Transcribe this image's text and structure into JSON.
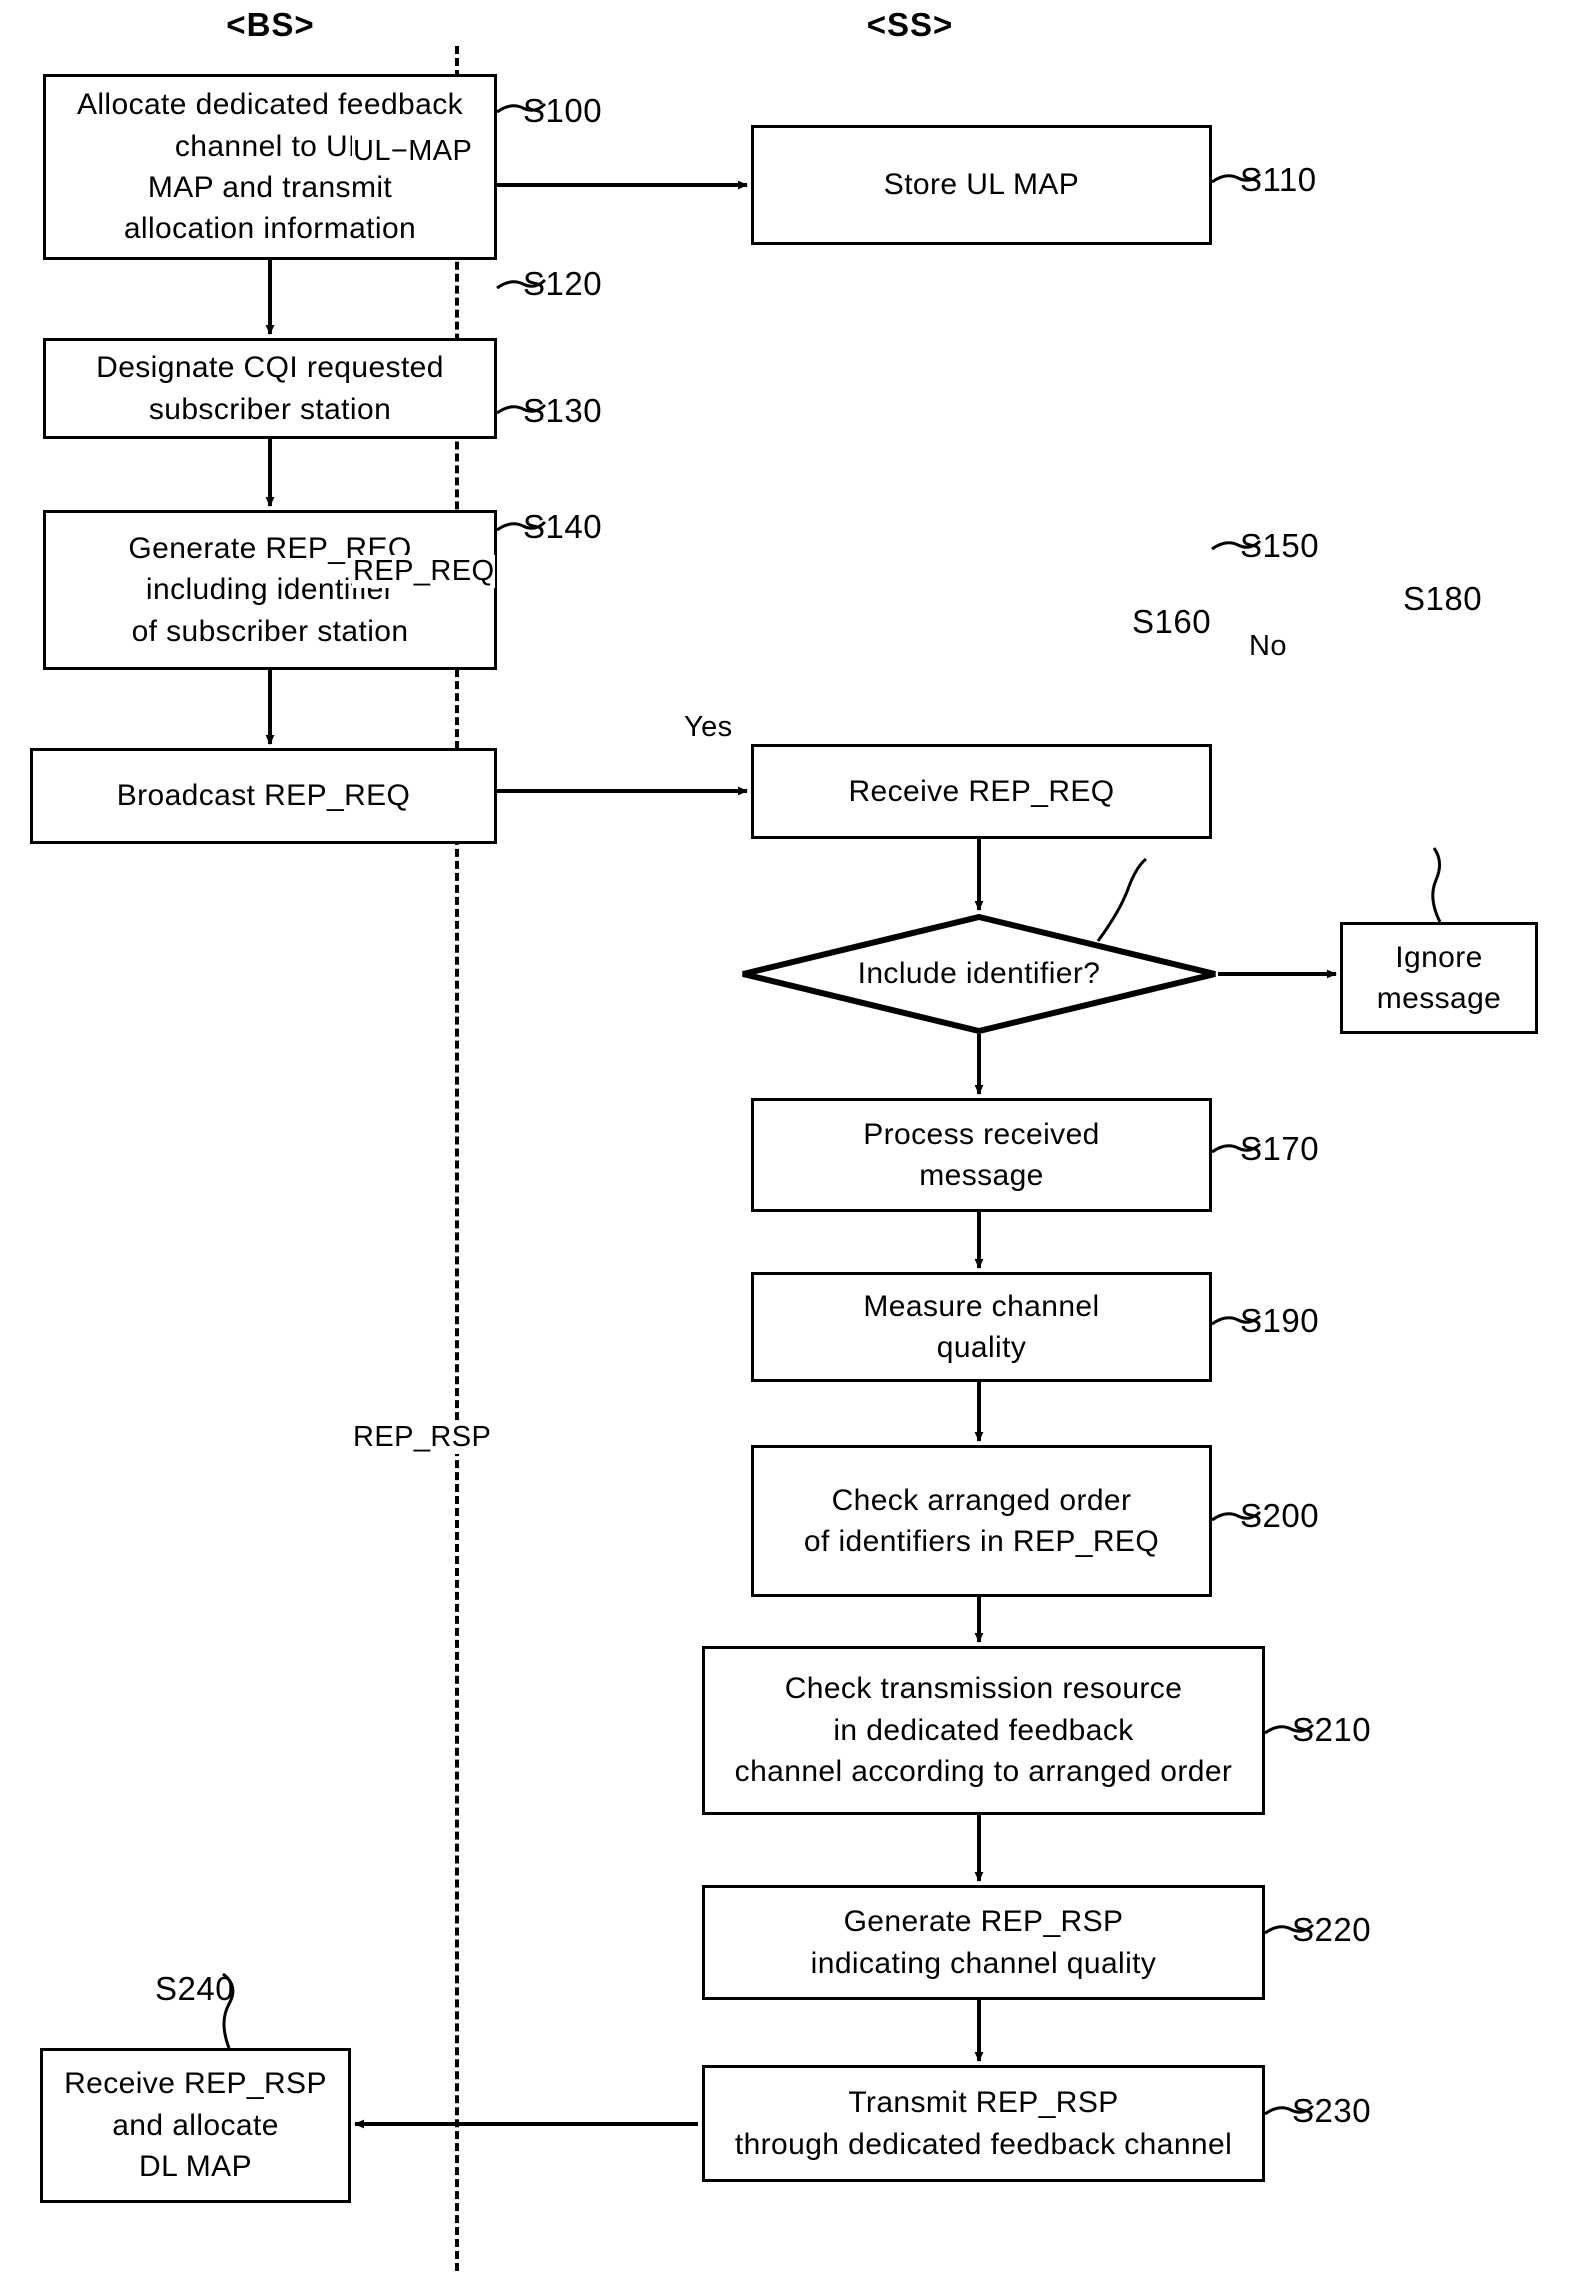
{
  "diagram": {
    "lanes": [
      {
        "id": "bs",
        "label": "<BS>"
      },
      {
        "id": "ss",
        "label": "<SS>"
      }
    ],
    "nodes": [
      {
        "id": "s100",
        "lane": "bs",
        "shape": "process",
        "text": "Allocate dedicated feedback\nchannel to UL\nMAP and transmit\nallocation information",
        "step": "S100"
      },
      {
        "id": "s110",
        "lane": "ss",
        "shape": "process",
        "text": "Store UL MAP",
        "step": "S110"
      },
      {
        "id": "s120",
        "lane": "bs",
        "shape": "process",
        "text": "Designate CQI requested\nsubscriber station",
        "step": "S120"
      },
      {
        "id": "s130",
        "lane": "bs",
        "shape": "process",
        "text": "Generate REP_REQ\nincluding identifier\nof subscriber station",
        "step": "S130"
      },
      {
        "id": "s140",
        "lane": "bs",
        "shape": "process",
        "text": "Broadcast REP_REQ",
        "step": "S140"
      },
      {
        "id": "s150",
        "lane": "ss",
        "shape": "process",
        "text": "Receive REP_REQ",
        "step": "S150"
      },
      {
        "id": "s160",
        "lane": "ss",
        "shape": "decision",
        "text": "Include identifier?",
        "step": "S160"
      },
      {
        "id": "s180",
        "lane": "ss",
        "shape": "process",
        "text": "Ignore\nmessage",
        "step": "S180"
      },
      {
        "id": "s170",
        "lane": "ss",
        "shape": "process",
        "text": "Process received\nmessage",
        "step": "S170"
      },
      {
        "id": "s190",
        "lane": "ss",
        "shape": "process",
        "text": "Measure channel\nquality",
        "step": "S190"
      },
      {
        "id": "s200",
        "lane": "ss",
        "shape": "process",
        "text": "Check arranged order\nof identifiers in REP_REQ",
        "step": "S200"
      },
      {
        "id": "s210",
        "lane": "ss",
        "shape": "process",
        "text": "Check transmission resource\nin dedicated feedback\nchannel according to arranged order",
        "step": "S210"
      },
      {
        "id": "s220",
        "lane": "ss",
        "shape": "process",
        "text": "Generate REP_RSP\nindicating channel quality",
        "step": "S220"
      },
      {
        "id": "s230",
        "lane": "ss",
        "shape": "process",
        "text": "Transmit REP_RSP\nthrough dedicated feedback channel",
        "step": "S230"
      },
      {
        "id": "s240",
        "lane": "bs",
        "shape": "process",
        "text": "Receive REP_RSP\nand allocate\nDL MAP",
        "step": "S240"
      }
    ],
    "edge_labels": [
      {
        "id": "ul_map",
        "text": "UL−MAP"
      },
      {
        "id": "rep_req",
        "text": "REP_REQ"
      },
      {
        "id": "rep_rsp",
        "text": "REP_RSP"
      },
      {
        "id": "branch_no",
        "text": "No"
      },
      {
        "id": "branch_yes",
        "text": "Yes"
      }
    ],
    "colors": {
      "line": "#000000",
      "background": "#ffffff",
      "text": "#000000"
    }
  }
}
